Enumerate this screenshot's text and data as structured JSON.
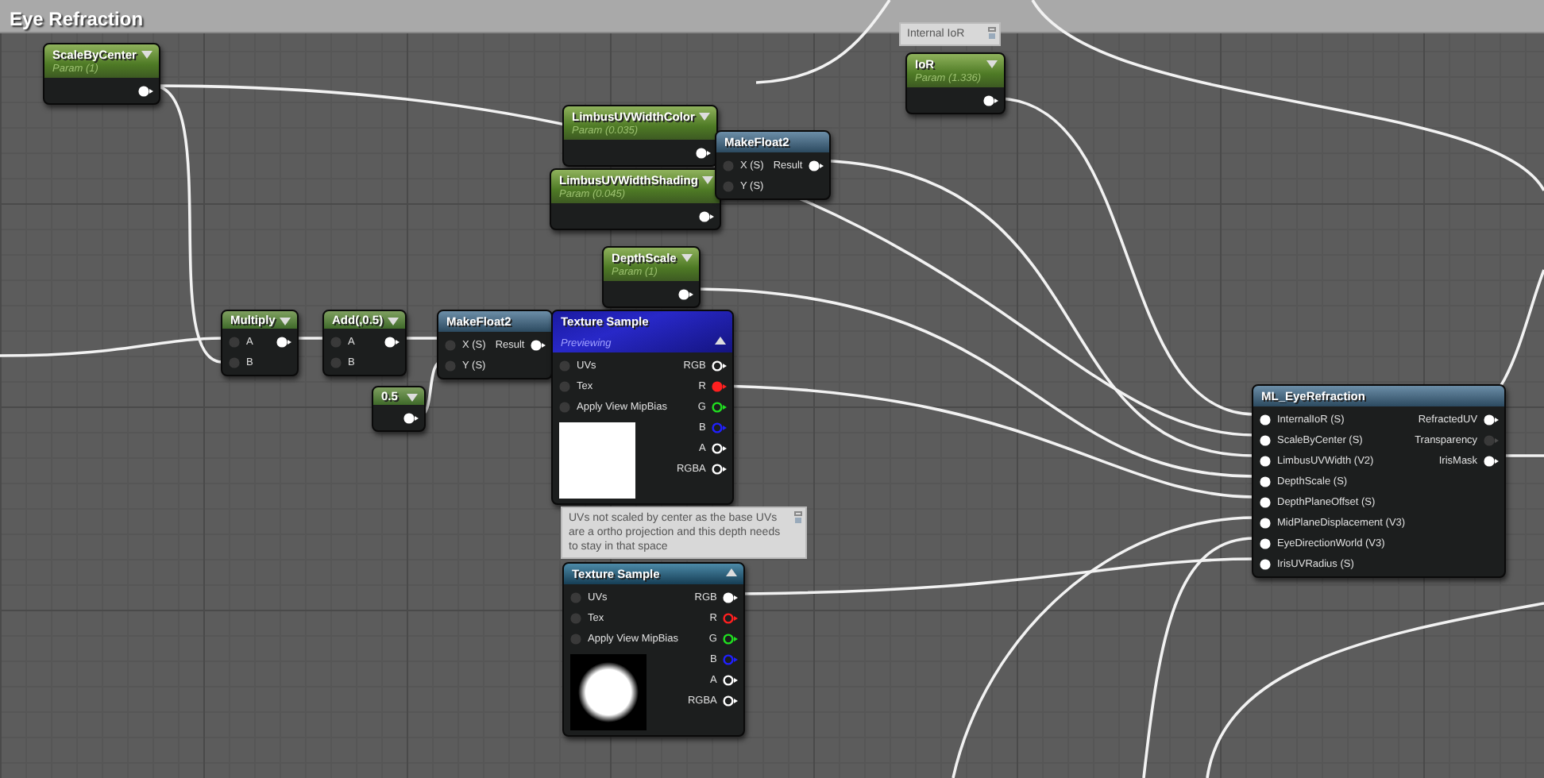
{
  "comment_box": {
    "title": "Eye Refraction"
  },
  "nodes": [
    {
      "kind": "param",
      "title": "ScaleByCenter",
      "subtitle": "Param (1)",
      "outputs": [
        {
          "connected": true
        }
      ]
    },
    {
      "kind": "param",
      "title": "IoR",
      "subtitle": "Param (1.336)",
      "outputs": [
        {
          "connected": true
        }
      ]
    },
    {
      "kind": "param",
      "title": "LimbusUVWidthColor",
      "subtitle": "Param (0.035)",
      "outputs": [
        {
          "connected": true
        }
      ]
    },
    {
      "kind": "param",
      "title": "LimbusUVWidthShading",
      "subtitle": "Param (0.045)",
      "outputs": [
        {
          "connected": true
        }
      ]
    },
    {
      "kind": "function",
      "title": "MakeFloat2",
      "inputs": [
        {
          "label": "X (S)",
          "connected": false
        },
        {
          "label": "Y (S)",
          "connected": false
        }
      ],
      "outputs": [
        {
          "label": "Result",
          "connected": true
        }
      ]
    },
    {
      "kind": "param",
      "title": "DepthScale",
      "subtitle": "Param (1)",
      "outputs": [
        {
          "connected": true
        }
      ]
    },
    {
      "kind": "math",
      "title": "Multiply",
      "inputs": [
        {
          "label": "A",
          "connected": false
        },
        {
          "label": "B",
          "connected": false
        }
      ],
      "outputs": [
        {
          "connected": true
        }
      ]
    },
    {
      "kind": "math",
      "title": "Add(,0.5)",
      "inputs": [
        {
          "label": "A",
          "connected": false
        },
        {
          "label": "B",
          "connected": false
        }
      ],
      "outputs": [
        {
          "connected": true
        }
      ]
    },
    {
      "kind": "function",
      "title": "MakeFloat2",
      "inputs": [
        {
          "label": "X (S)",
          "connected": false
        },
        {
          "label": "Y (S)",
          "connected": false
        }
      ],
      "outputs": [
        {
          "label": "Result",
          "connected": true
        }
      ]
    },
    {
      "kind": "math",
      "title": "0.5",
      "outputs": [
        {
          "connected": true
        }
      ]
    },
    {
      "kind": "texture",
      "title": "Texture Sample",
      "subtitle": "Previewing",
      "previewing": true,
      "preview": {
        "kind": "solid"
      },
      "inputs": [
        {
          "label": "UVs",
          "connected": false
        },
        {
          "label": "Tex",
          "connected": false
        },
        {
          "label": "Apply View MipBias",
          "connected": false
        }
      ],
      "outputs": [
        {
          "label": "RGB",
          "connected": false,
          "color": "#ffffff"
        },
        {
          "label": "R",
          "connected": true,
          "color": "#ff2020"
        },
        {
          "label": "G",
          "connected": false,
          "color": "#20e020"
        },
        {
          "label": "B",
          "connected": false,
          "color": "#2020ff"
        },
        {
          "label": "A",
          "connected": false,
          "color": "#ffffff"
        },
        {
          "label": "RGBA",
          "connected": false,
          "color": "#ffffff"
        }
      ]
    },
    {
      "kind": "texture",
      "title": "Texture Sample",
      "previewing": false,
      "preview": {
        "kind": "disc"
      },
      "inputs": [
        {
          "label": "UVs",
          "connected": false
        },
        {
          "label": "Tex",
          "connected": false
        },
        {
          "label": "Apply View MipBias",
          "connected": false
        }
      ],
      "outputs": [
        {
          "label": "RGB",
          "connected": true,
          "color": "#ffffff"
        },
        {
          "label": "R",
          "connected": false,
          "color": "#ff2020"
        },
        {
          "label": "G",
          "connected": false,
          "color": "#20e020"
        },
        {
          "label": "B",
          "connected": false,
          "color": "#2020ff"
        },
        {
          "label": "A",
          "connected": false,
          "color": "#ffffff"
        },
        {
          "label": "RGBA",
          "connected": false,
          "color": "#ffffff"
        }
      ]
    },
    {
      "kind": "function",
      "title": "ML_EyeRefraction",
      "inputs": [
        {
          "label": "InternalIoR (S)",
          "connected": true
        },
        {
          "label": "ScaleByCenter (S)",
          "connected": true
        },
        {
          "label": "LimbusUVWidth (V2)",
          "connected": true
        },
        {
          "label": "DepthScale (S)",
          "connected": true
        },
        {
          "label": "DepthPlaneOffset (S)",
          "connected": true
        },
        {
          "label": "MidPlaneDisplacement (V3)",
          "connected": true
        },
        {
          "label": "EyeDirectionWorld (V3)",
          "connected": true
        },
        {
          "label": "IrisUVRadius (S)",
          "connected": true
        }
      ],
      "outputs": [
        {
          "label": "RefractedUV",
          "connected": true
        },
        {
          "label": "Transparency",
          "connected": false
        },
        {
          "label": "IrisMask",
          "connected": true
        }
      ]
    }
  ],
  "comments": [
    {
      "text": "Internal IoR"
    },
    {
      "text": "UVs not scaled by center as the base UVs are a ortho projection and this depth needs to stay in that space"
    }
  ]
}
